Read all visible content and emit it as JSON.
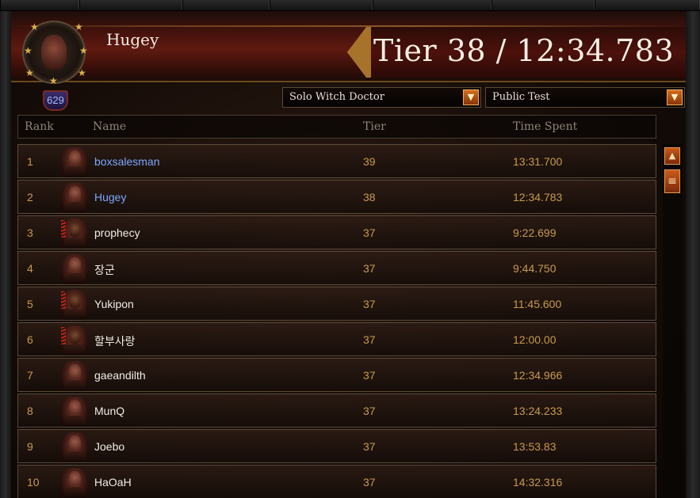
{
  "player": {
    "name": "Hugey",
    "paragon_level": "629"
  },
  "result_title": "Tier 38 / 12:34.783",
  "filters": {
    "class_select": "Solo Witch Doctor",
    "region_select": "Public Test"
  },
  "table": {
    "headers": {
      "rank": "Rank",
      "name": "Name",
      "tier": "Tier",
      "time": "Time Spent"
    },
    "rows": [
      {
        "rank": "1",
        "name": "boxsalesman",
        "tier": "39",
        "time": "13:31.700"
      },
      {
        "rank": "2",
        "name": "Hugey",
        "tier": "38",
        "time": "12:34.783"
      },
      {
        "rank": "3",
        "name": "prophecy",
        "tier": "37",
        "time": "9:22.699"
      },
      {
        "rank": "4",
        "name": "장군",
        "tier": "37",
        "time": "9:44.750"
      },
      {
        "rank": "5",
        "name": "Yukipon",
        "tier": "37",
        "time": "11:45.600"
      },
      {
        "rank": "6",
        "name": "할부사랑",
        "tier": "37",
        "time": "12:00.00"
      },
      {
        "rank": "7",
        "name": "gaeandilth",
        "tier": "37",
        "time": "12:34.966"
      },
      {
        "rank": "8",
        "name": "MunQ",
        "tier": "37",
        "time": "13:24.233"
      },
      {
        "rank": "9",
        "name": "Joebo",
        "tier": "37",
        "time": "13:53.83"
      },
      {
        "rank": "10",
        "name": "HaOaH",
        "tier": "37",
        "time": "14:32.316"
      }
    ]
  },
  "colors": {
    "link_name": "#7aa7ff",
    "value_gold": "#c89b4e",
    "accent_orange": "#d36c1e"
  },
  "icons": {
    "dropdown": "chevron-down-icon",
    "scroll_up": "arrow-up-icon",
    "scroll_thumb": "grip-icon"
  }
}
